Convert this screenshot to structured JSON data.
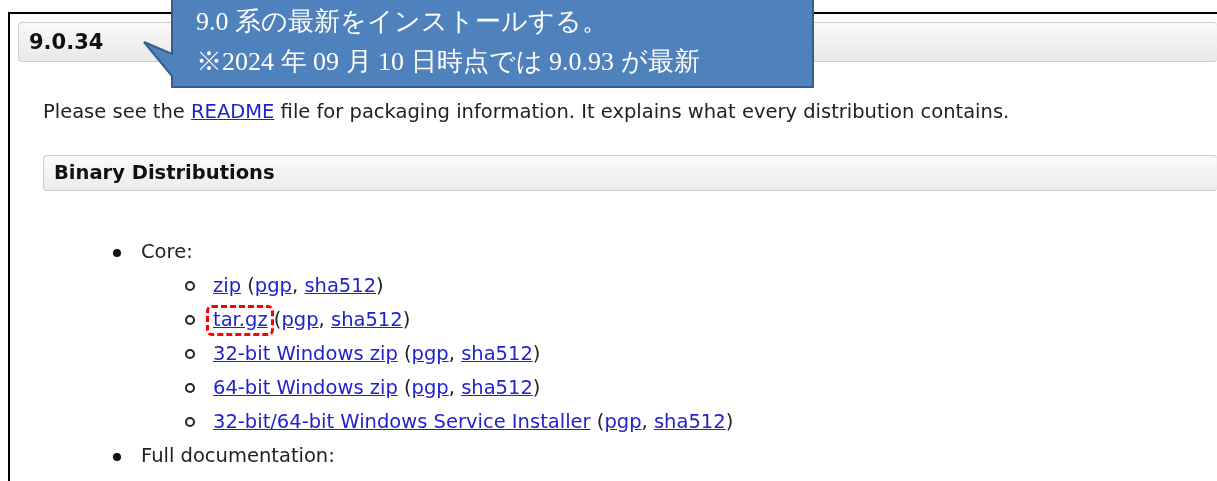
{
  "callout": {
    "lines": [
      "9.0 系の最新をインストールする。",
      "※2024 年 09 月 10 日時点では 9.0.93 が最新"
    ]
  },
  "version_heading": "9.0.34",
  "intro": {
    "before": "Please see the ",
    "link": "README",
    "after": " file for packaging information. It explains what every distribution contains."
  },
  "section_heading": "Binary Distributions",
  "list": [
    {
      "label": "Core:",
      "children": [
        {
          "highlighted": false,
          "parts": [
            {
              "kind": "link",
              "text": "zip"
            },
            {
              "kind": "text",
              "text": " ("
            },
            {
              "kind": "link",
              "text": "pgp"
            },
            {
              "kind": "text",
              "text": ", "
            },
            {
              "kind": "link",
              "text": "sha512"
            },
            {
              "kind": "text",
              "text": ")"
            }
          ]
        },
        {
          "highlighted": true,
          "parts": [
            {
              "kind": "link",
              "text": "tar.gz"
            },
            {
              "kind": "text",
              "text": " ("
            },
            {
              "kind": "link",
              "text": "pgp"
            },
            {
              "kind": "text",
              "text": ", "
            },
            {
              "kind": "link",
              "text": "sha512"
            },
            {
              "kind": "text",
              "text": ")"
            }
          ]
        },
        {
          "highlighted": false,
          "parts": [
            {
              "kind": "link",
              "text": "32-bit Windows zip"
            },
            {
              "kind": "text",
              "text": " ("
            },
            {
              "kind": "link",
              "text": "pgp"
            },
            {
              "kind": "text",
              "text": ", "
            },
            {
              "kind": "link",
              "text": "sha512"
            },
            {
              "kind": "text",
              "text": ")"
            }
          ]
        },
        {
          "highlighted": false,
          "parts": [
            {
              "kind": "link",
              "text": "64-bit Windows zip"
            },
            {
              "kind": "text",
              "text": " ("
            },
            {
              "kind": "link",
              "text": "pgp"
            },
            {
              "kind": "text",
              "text": ", "
            },
            {
              "kind": "link",
              "text": "sha512"
            },
            {
              "kind": "text",
              "text": ")"
            }
          ]
        },
        {
          "highlighted": false,
          "parts": [
            {
              "kind": "link",
              "text": "32-bit/64-bit Windows Service Installer"
            },
            {
              "kind": "text",
              "text": " ("
            },
            {
              "kind": "link",
              "text": "pgp"
            },
            {
              "kind": "text",
              "text": ", "
            },
            {
              "kind": "link",
              "text": "sha512"
            },
            {
              "kind": "text",
              "text": ")"
            }
          ]
        }
      ]
    },
    {
      "label": "Full documentation:"
    }
  ]
}
